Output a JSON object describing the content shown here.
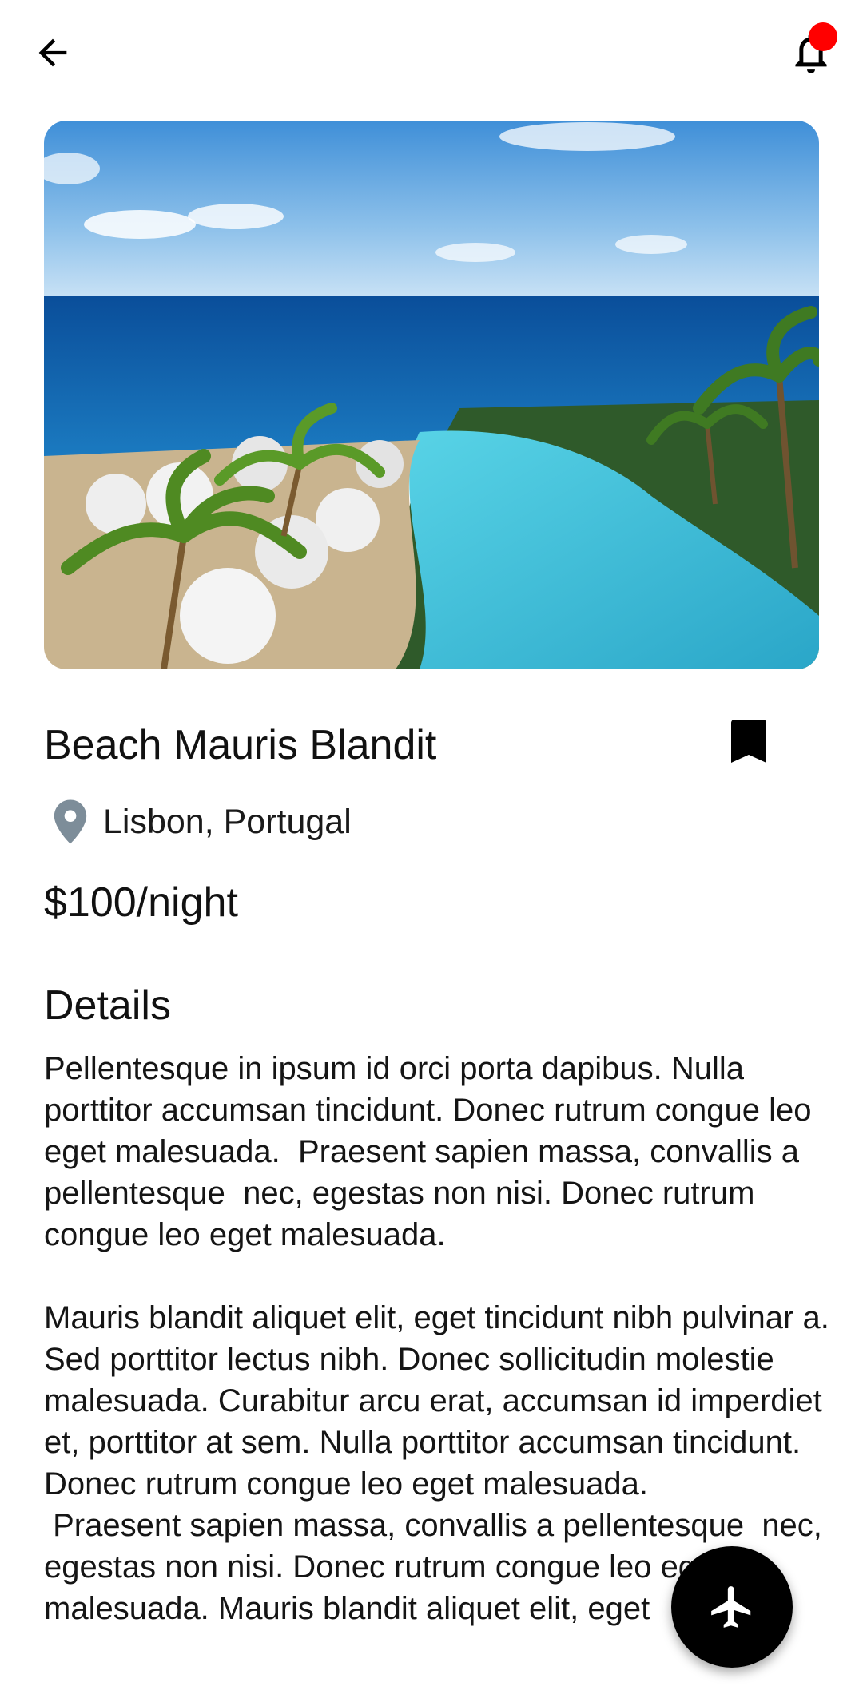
{
  "header": {
    "back_icon": "arrow-left-icon",
    "notification_icon": "bell-icon",
    "notification_badge_color": "#ff0000"
  },
  "listing": {
    "title": "Beach Mauris Blandit",
    "bookmark_icon": "bookmark-icon",
    "location_icon": "map-pin-icon",
    "location": "Lisbon, Portugal",
    "price": "$100/night"
  },
  "details": {
    "heading": "Details",
    "body": "Pellentesque in ipsum id orci porta dapibus. Nulla porttitor accumsan tincidunt. Donec rutrum congue leo eget malesuada.  Praesent sapien massa, convallis a pellentesque  nec, egestas non nisi. Donec rutrum congue leo eget malesuada.\n\nMauris blandit aliquet elit, eget tincidunt nibh pulvinar a. Sed porttitor lectus nibh. Donec sollicitudin molestie malesuada. Curabitur arcu erat, accumsan id imperdiet et, porttitor at sem. Nulla porttitor accumsan tincidunt. Donec rutrum congue leo eget malesuada.\n Praesent sapien massa, convallis a pellentesque  nec, egestas non nisi. Donec rutrum congue leo eget malesuada. Mauris blandit aliquet elit, eget"
  },
  "fab": {
    "icon": "airplane-icon",
    "color": "#000000"
  }
}
